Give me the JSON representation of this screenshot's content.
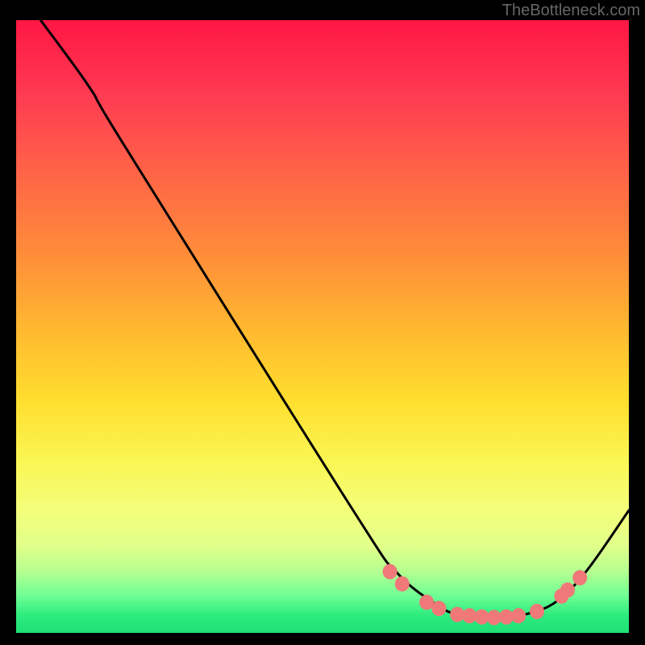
{
  "attribution": "TheBottleneck.com",
  "chart_data": {
    "type": "line",
    "title": "",
    "xlabel": "",
    "ylabel": "",
    "xlim": [
      0,
      100
    ],
    "ylim": [
      0,
      100
    ],
    "background": {
      "type": "vertical-gradient",
      "stops": [
        {
          "offset": 0,
          "color": "#ff1744"
        },
        {
          "offset": 12,
          "color": "#ff3a52"
        },
        {
          "offset": 25,
          "color": "#ff6447"
        },
        {
          "offset": 38,
          "color": "#ff8c3a"
        },
        {
          "offset": 50,
          "color": "#ffb730"
        },
        {
          "offset": 62,
          "color": "#ffde2e"
        },
        {
          "offset": 72,
          "color": "#faf654"
        },
        {
          "offset": 80,
          "color": "#f4ff7a"
        },
        {
          "offset": 86,
          "color": "#e0ff8a"
        },
        {
          "offset": 90,
          "color": "#b4ff90"
        },
        {
          "offset": 94,
          "color": "#6eff94"
        },
        {
          "offset": 97,
          "color": "#2fec7f"
        },
        {
          "offset": 100,
          "color": "#1ee074"
        }
      ]
    },
    "curve": {
      "points": [
        {
          "x": 4,
          "y": 100
        },
        {
          "x": 12,
          "y": 89
        },
        {
          "x": 18,
          "y": 79
        },
        {
          "x": 55,
          "y": 20
        },
        {
          "x": 62,
          "y": 10
        },
        {
          "x": 68,
          "y": 5
        },
        {
          "x": 72,
          "y": 3
        },
        {
          "x": 78,
          "y": 2.5
        },
        {
          "x": 83,
          "y": 3
        },
        {
          "x": 88,
          "y": 5
        },
        {
          "x": 93,
          "y": 10
        },
        {
          "x": 100,
          "y": 20
        }
      ],
      "color": "#000000",
      "width": 3
    },
    "markers": {
      "points": [
        {
          "x": 61,
          "y": 10
        },
        {
          "x": 63,
          "y": 8
        },
        {
          "x": 67,
          "y": 5
        },
        {
          "x": 69,
          "y": 4
        },
        {
          "x": 72,
          "y": 3
        },
        {
          "x": 74,
          "y": 2.8
        },
        {
          "x": 76,
          "y": 2.6
        },
        {
          "x": 78,
          "y": 2.5
        },
        {
          "x": 80,
          "y": 2.6
        },
        {
          "x": 82,
          "y": 2.8
        },
        {
          "x": 85,
          "y": 3.5
        },
        {
          "x": 89,
          "y": 6
        },
        {
          "x": 90,
          "y": 7
        },
        {
          "x": 92,
          "y": 9
        }
      ],
      "color": "#f07878",
      "radius": 9
    }
  }
}
